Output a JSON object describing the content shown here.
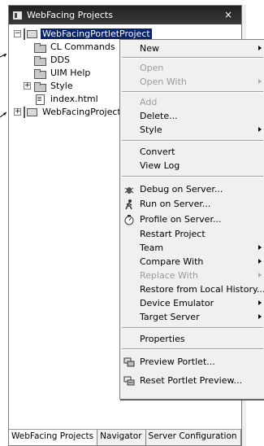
{
  "view": {
    "title": "WebFacing Projects",
    "close_glyph": "×"
  },
  "tree": {
    "root_label": "WebFacingPortletProject",
    "children": [
      {
        "label": "CL Commands",
        "icon": "folder-icon"
      },
      {
        "label": "DDS",
        "icon": "folder-icon"
      },
      {
        "label": "UIM Help",
        "icon": "folder-icon"
      },
      {
        "label": "Style",
        "icon": "style-folder-icon"
      },
      {
        "label": "index.html",
        "icon": "html-file-icon"
      }
    ],
    "second_project": "WebFacingProject",
    "expanded_glyph": "−",
    "collapsed_glyph": "+"
  },
  "menu": {
    "items": [
      {
        "label": "New",
        "enabled": true,
        "submenu": true
      },
      {
        "label": "Open",
        "enabled": false,
        "submenu": false
      },
      {
        "label": "Open With",
        "enabled": false,
        "submenu": true
      },
      {
        "label": "Add",
        "enabled": false,
        "submenu": false
      },
      {
        "label": "Delete...",
        "enabled": true,
        "submenu": false
      },
      {
        "label": "Style",
        "enabled": true,
        "submenu": true
      },
      {
        "label": "Convert",
        "enabled": true,
        "submenu": false
      },
      {
        "label": "View Log",
        "enabled": true,
        "submenu": false
      },
      {
        "label": "Debug on Server...",
        "enabled": true,
        "submenu": false,
        "icon": "debug-icon"
      },
      {
        "label": "Run on Server...",
        "enabled": true,
        "submenu": false,
        "icon": "run-icon"
      },
      {
        "label": "Profile on Server...",
        "enabled": true,
        "submenu": false,
        "icon": "profile-icon"
      },
      {
        "label": "Restart Project",
        "enabled": true,
        "submenu": false
      },
      {
        "label": "Team",
        "enabled": true,
        "submenu": true
      },
      {
        "label": "Compare With",
        "enabled": true,
        "submenu": true
      },
      {
        "label": "Replace With",
        "enabled": false,
        "submenu": true
      },
      {
        "label": "Restore from Local History...",
        "enabled": true,
        "submenu": false
      },
      {
        "label": "Device Emulator",
        "enabled": true,
        "submenu": true
      },
      {
        "label": "Target Server",
        "enabled": true,
        "submenu": true
      },
      {
        "label": "Properties",
        "enabled": true,
        "submenu": false
      },
      {
        "label": "Preview Portlet...",
        "enabled": true,
        "submenu": false,
        "icon": "preview-portlet-icon"
      },
      {
        "label": "Reset Portlet Preview...",
        "enabled": true,
        "submenu": false,
        "icon": "reset-preview-icon"
      }
    ]
  },
  "bottom_tabs": [
    {
      "label": "WebFacing Projects",
      "active": true
    },
    {
      "label": "Navigator",
      "active": false
    },
    {
      "label": "Server Configuration",
      "active": false
    }
  ]
}
